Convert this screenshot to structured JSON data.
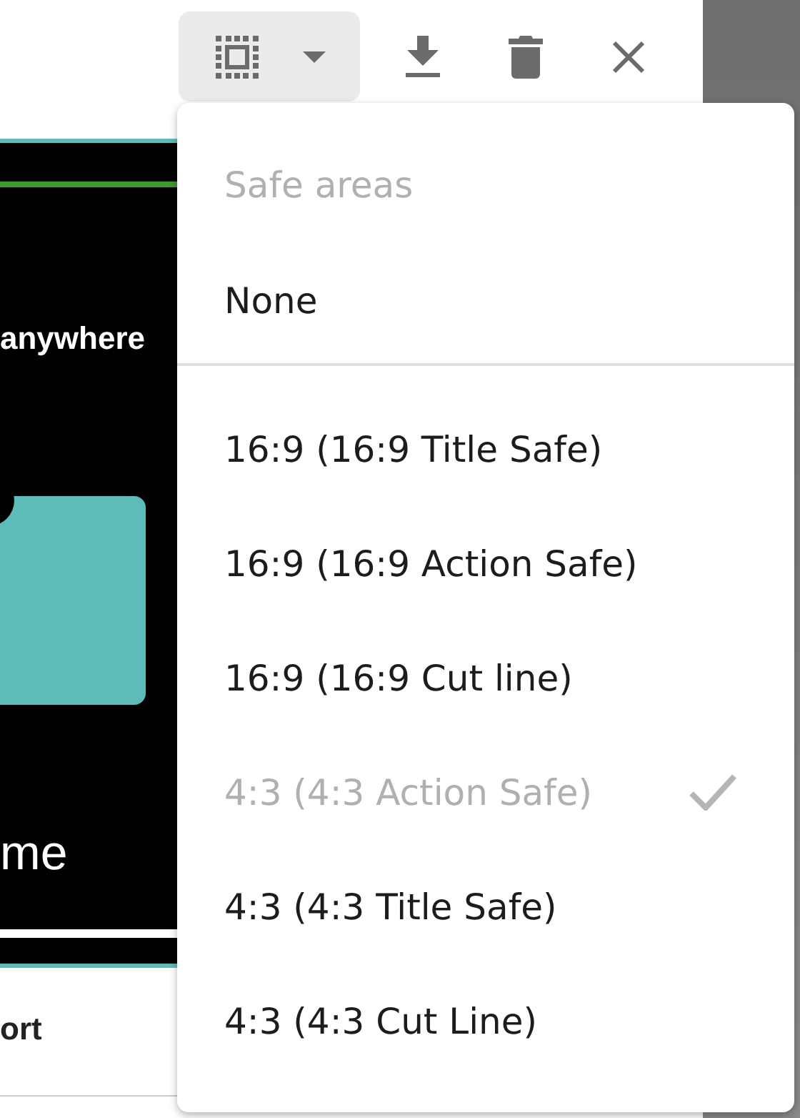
{
  "preview": {
    "heading": "anywhere",
    "caption": "me"
  },
  "below_preview": "ort",
  "menu": {
    "header": "Safe areas",
    "sections": [
      {
        "items": [
          {
            "label": "None",
            "selected": false
          }
        ]
      },
      {
        "items": [
          {
            "label": "16:9 (16:9 Title Safe)",
            "selected": false
          },
          {
            "label": "16:9 (16:9 Action Safe)",
            "selected": false
          },
          {
            "label": "16:9 (16:9 Cut line)",
            "selected": false
          },
          {
            "label": "4:3 (4:3 Action Safe)",
            "selected": true
          },
          {
            "label": "4:3 (4:3 Title Safe)",
            "selected": false
          },
          {
            "label": "4:3 (4:3 Cut Line)",
            "selected": false
          }
        ]
      }
    ]
  }
}
